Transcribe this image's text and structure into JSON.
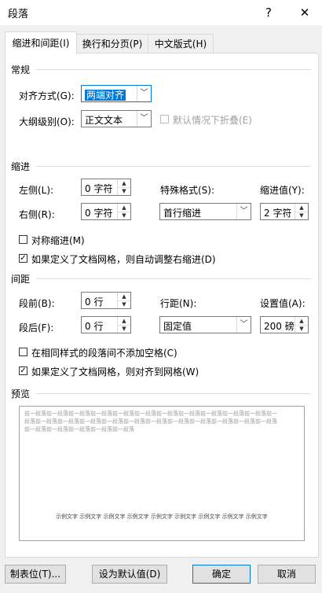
{
  "window": {
    "title": "段落",
    "help_label": "?",
    "close_label": "✕"
  },
  "tabs": [
    {
      "label": "缩进和间距(I)",
      "active": true
    },
    {
      "label": "换行和分页(P)",
      "active": false
    },
    {
      "label": "中文版式(H)",
      "active": false
    }
  ],
  "general": {
    "heading": "常规",
    "alignment_label": "对齐方式(G):",
    "alignment_value": "两端对齐",
    "outline_label": "大纲级别(O):",
    "outline_value": "正文文本",
    "collapse_label": "默认情况下折叠(E)",
    "collapse_checked": false
  },
  "indent": {
    "heading": "缩进",
    "left_label": "左侧(L):",
    "left_value": "0 字符",
    "right_label": "右侧(R):",
    "right_value": "0 字符",
    "special_label": "特殊格式(S):",
    "special_value": "首行缩进",
    "by_label": "缩进值(Y):",
    "by_value": "2 字符",
    "mirror_label": "对称缩进(M)",
    "mirror_checked": false,
    "grid_label": "如果定义了文档网格，则自动调整右缩进(D)",
    "grid_checked": true
  },
  "spacing": {
    "heading": "间距",
    "before_label": "段前(B):",
    "before_value": "0 行",
    "after_label": "段后(F):",
    "after_value": "0 行",
    "line_label": "行距(N):",
    "line_value": "固定值",
    "at_label": "设置值(A):",
    "at_value": "200 磅",
    "nospace_label": "在相同样式的段落间不添加空格(C)",
    "nospace_checked": false,
    "snap_label": "如果定义了文档网格，则对齐到网格(W)",
    "snap_checked": true
  },
  "preview": {
    "heading": "预览",
    "prev_line1": "前一段落前一段落前一段落前一段落前一段落前一段落前一段落前一段落前一段落前一段落前一段落前一",
    "prev_line2": "段落前一段落前一段落前一段落前一段落前一段落前一段落前一段落前一段落前一段落前一段落前一段落",
    "prev_line3": "前一段落前一段落前一段落前一段落前一段落",
    "sample": "示例文字 示例文字 示例文字 示例文字 示例文字 示例文字 示例文字 示例文字 示例文字"
  },
  "buttons": {
    "tabs": "制表位(T)...",
    "default": "设为默认值(D)",
    "ok": "确定",
    "cancel": "取消"
  },
  "colors": {
    "accent": "#0078d7"
  }
}
